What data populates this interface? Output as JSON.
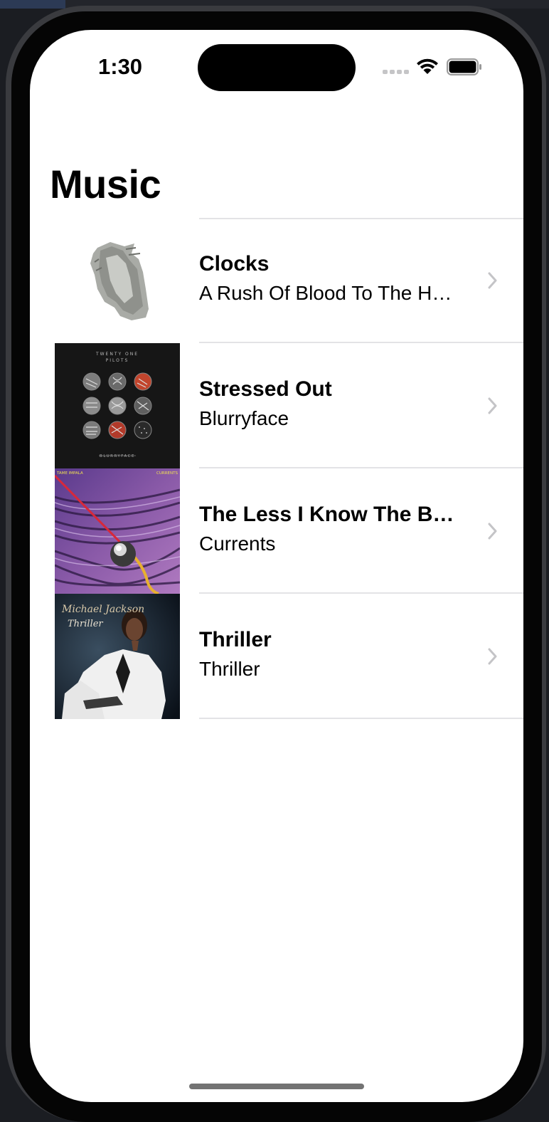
{
  "status_bar": {
    "time": "1:30"
  },
  "nav": {
    "title": "Music"
  },
  "songs": [
    {
      "title": "Clocks",
      "album": "A Rush Of Blood To The H…",
      "artwork": "coldplay-statue-cover"
    },
    {
      "title": "Stressed Out",
      "album": "Blurryface",
      "artwork": "blurryface-cover",
      "artwork_text": {
        "line1": "TWENTY ONE",
        "line2": "PILOTS",
        "bottom": "BLURRYFACE"
      }
    },
    {
      "title": "The Less I Know The B…",
      "album": "Currents",
      "artwork": "currents-cover",
      "artwork_text": {
        "left": "TAME IMPALA",
        "right": "CURRENTS"
      }
    },
    {
      "title": "Thriller",
      "album": "Thriller",
      "artwork": "thriller-cover",
      "artwork_text": {
        "script": "Michael Jackson",
        "title": "Thriller"
      }
    }
  ],
  "colors": {
    "background": "#ffffff",
    "separator": "#e3e3e6",
    "chevron": "#c4c4c7",
    "text": "#000000"
  }
}
